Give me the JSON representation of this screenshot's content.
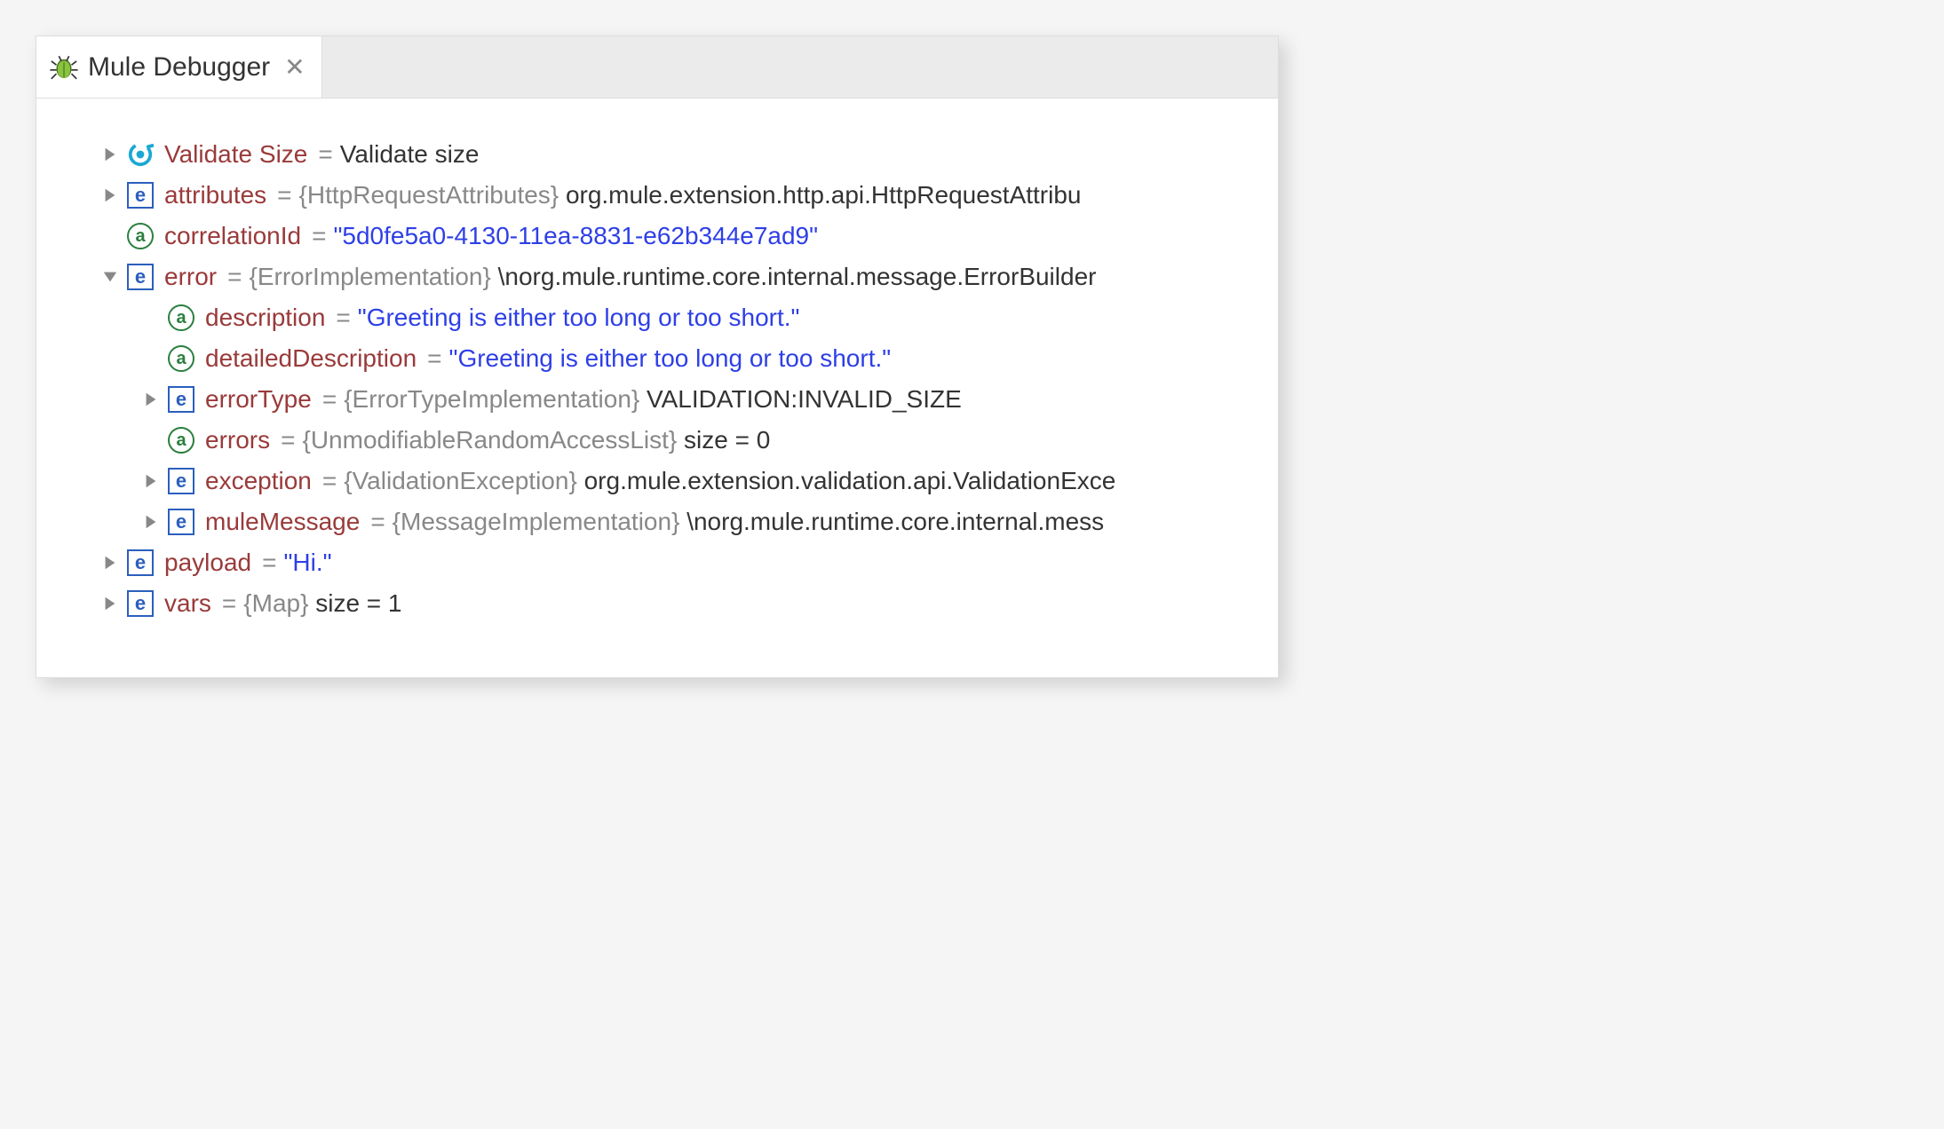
{
  "tab": {
    "title": "Mule Debugger"
  },
  "tree": {
    "validateSize": {
      "name": "Validate Size",
      "value": "Validate size"
    },
    "attributes": {
      "name": "attributes",
      "type": "{HttpRequestAttributes}",
      "value": "org.mule.extension.http.api.HttpRequestAttribu"
    },
    "correlationId": {
      "name": "correlationId",
      "value": "\"5d0fe5a0-4130-11ea-8831-e62b344e7ad9\""
    },
    "error": {
      "name": "error",
      "type": "{ErrorImplementation}",
      "value": "\\norg.mule.runtime.core.internal.message.ErrorBuilder",
      "children": {
        "description": {
          "name": "description",
          "value": "\"Greeting is either too long or too short.\""
        },
        "detailedDescription": {
          "name": "detailedDescription",
          "value": "\"Greeting is either too long or too short.\""
        },
        "errorType": {
          "name": "errorType",
          "type": "{ErrorTypeImplementation}",
          "value": "VALIDATION:INVALID_SIZE"
        },
        "errors": {
          "name": "errors",
          "type": "{UnmodifiableRandomAccessList}",
          "value": "size = 0"
        },
        "exception": {
          "name": "exception",
          "type": "{ValidationException}",
          "value": "org.mule.extension.validation.api.ValidationExce"
        },
        "muleMessage": {
          "name": "muleMessage",
          "type": "{MessageImplementation}",
          "value": "\\norg.mule.runtime.core.internal.mess"
        }
      }
    },
    "payload": {
      "name": "payload",
      "value": "\"Hi.\""
    },
    "vars": {
      "name": "vars",
      "type": "{Map}",
      "value": "size = 1"
    }
  }
}
